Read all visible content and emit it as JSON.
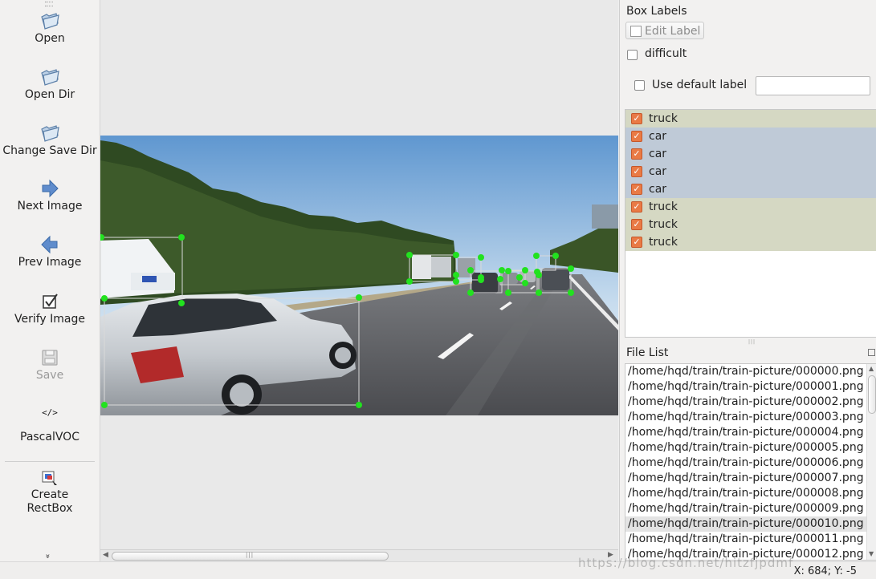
{
  "toolbar": {
    "open": "Open",
    "open_dir": "Open Dir",
    "change_save_dir": "Change Save Dir",
    "next_image": "Next Image",
    "prev_image": "Prev Image",
    "verify_image": "Verify Image",
    "save": "Save",
    "format_icon_text": "</>",
    "format": "PascalVOC",
    "create_rectbox_line1": "Create",
    "create_rectbox_line2": "RectBox",
    "more": "»"
  },
  "box_labels": {
    "title": "Box Labels",
    "edit_label_button": "Edit Label",
    "difficult": "difficult",
    "use_default_label": "Use default label",
    "default_label_value": "",
    "labels": [
      {
        "text": "truck",
        "checked": true,
        "color": "#d5d8c3"
      },
      {
        "text": "car",
        "checked": true,
        "color": "#bfcad7"
      },
      {
        "text": "car",
        "checked": true,
        "color": "#bfcad7"
      },
      {
        "text": "car",
        "checked": true,
        "color": "#bfcad7"
      },
      {
        "text": "car",
        "checked": true,
        "color": "#bfcad7"
      },
      {
        "text": "truck",
        "checked": true,
        "color": "#d5d8c3"
      },
      {
        "text": "truck",
        "checked": true,
        "color": "#d5d8c3"
      },
      {
        "text": "truck",
        "checked": true,
        "color": "#d5d8c3"
      }
    ]
  },
  "file_list": {
    "title": "File List",
    "files": [
      "/home/hqd/train/train-picture/000000.png",
      "/home/hqd/train/train-picture/000001.png",
      "/home/hqd/train/train-picture/000002.png",
      "/home/hqd/train/train-picture/000003.png",
      "/home/hqd/train/train-picture/000004.png",
      "/home/hqd/train/train-picture/000005.png",
      "/home/hqd/train/train-picture/000006.png",
      "/home/hqd/train/train-picture/000007.png",
      "/home/hqd/train/train-picture/000008.png",
      "/home/hqd/train/train-picture/000009.png",
      "/home/hqd/train/train-picture/000010.png",
      "/home/hqd/train/train-picture/000011.png",
      "/home/hqd/train/train-picture/000012.png"
    ],
    "selected_index": 10
  },
  "status": {
    "coords": "X: 684; Y: -5",
    "watermark": "https://blog.csdn.net/hitzfjpdmf"
  },
  "colors": {
    "point": "#22e21f",
    "truck_row": "#d5d8c3",
    "car_row": "#bfcad7",
    "checkbox": "#e97a45"
  }
}
